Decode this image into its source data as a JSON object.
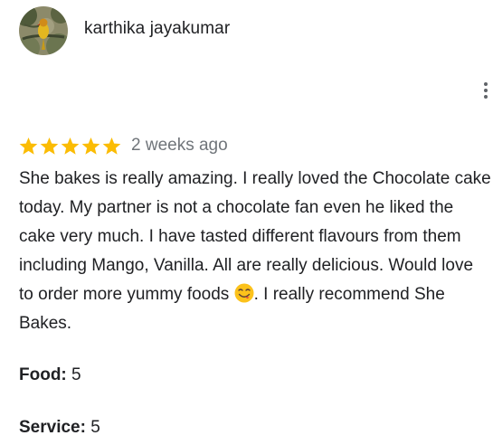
{
  "review": {
    "author_name": "karthika jayakumar",
    "rating": 5,
    "rating_max": 5,
    "star_color": "#fbbc04",
    "timestamp": "2 weeks ago",
    "text_before_emoji": "She bakes is really amazing. I really loved the Chocolate cake today. My partner is not a chocolate fan even he liked the cake very much. I have tasted different flavours from them including Mango, Vanilla. All are really delicious. Would love to order more yummy foods",
    "emoji_icon": "face-savoring-food-icon",
    "text_after_emoji": ". I really recommend She Bakes.",
    "attributes": [
      {
        "label": "Food:",
        "value": "5"
      },
      {
        "label": "Service:",
        "value": "5"
      }
    ]
  },
  "icons": {
    "more_menu": "more-vert-icon",
    "avatar": "parrot-avatar"
  }
}
